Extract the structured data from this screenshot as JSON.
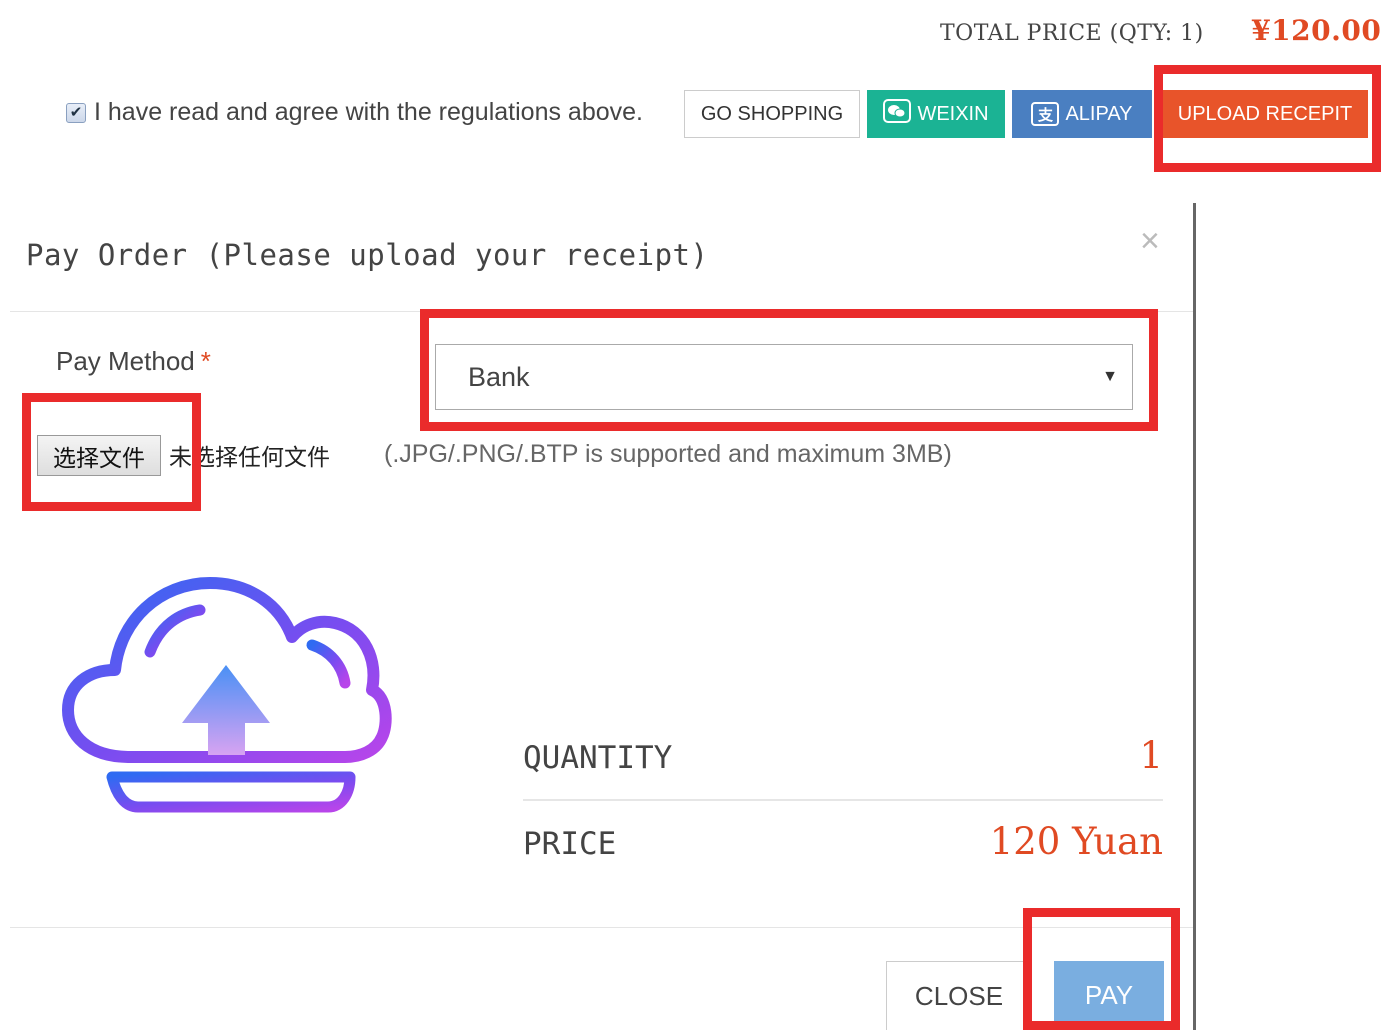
{
  "header": {
    "total_label": "TOTAL PRICE (QTY:  1)",
    "total_amount": "¥120.00"
  },
  "agreement": {
    "checked": true,
    "text": "I have read and agree with the regulations above."
  },
  "actions": {
    "go_shopping": "GO SHOPPING",
    "weixin": "WEIXIN",
    "alipay": "ALIPAY",
    "alipay_icon_glyph": "支",
    "upload_receipt": "UPLOAD RECEPIT"
  },
  "modal": {
    "title": "Pay Order (Please upload your receipt)",
    "close_glyph": "×",
    "pay_method_label": "Pay Method",
    "required_mark": "*",
    "pay_method_value": "Bank",
    "select_caret": "▼",
    "file_button": "选择文件",
    "file_status": "未选择任何文件",
    "file_hint": "(.JPG/.PNG/.BTP is supported and maximum 3MB)",
    "summary": {
      "quantity_label": "QUANTITY",
      "quantity_value": "1",
      "price_label": "PRICE",
      "price_value": "120 Yuan"
    },
    "close_button": "CLOSE",
    "pay_button": "PAY"
  },
  "colors": {
    "accent_red": "#e04a23",
    "weixin_green": "#1bb394",
    "alipay_blue": "#4a7fc1",
    "upload_orange": "#e8542a",
    "pay_blue": "#7aaee0",
    "highlight_red": "#ea2b2b"
  },
  "icons": [
    "checkbox-check-icon",
    "weixin-icon",
    "alipay-icon",
    "close-icon",
    "dropdown-caret-icon",
    "cloud-upload-icon"
  ]
}
